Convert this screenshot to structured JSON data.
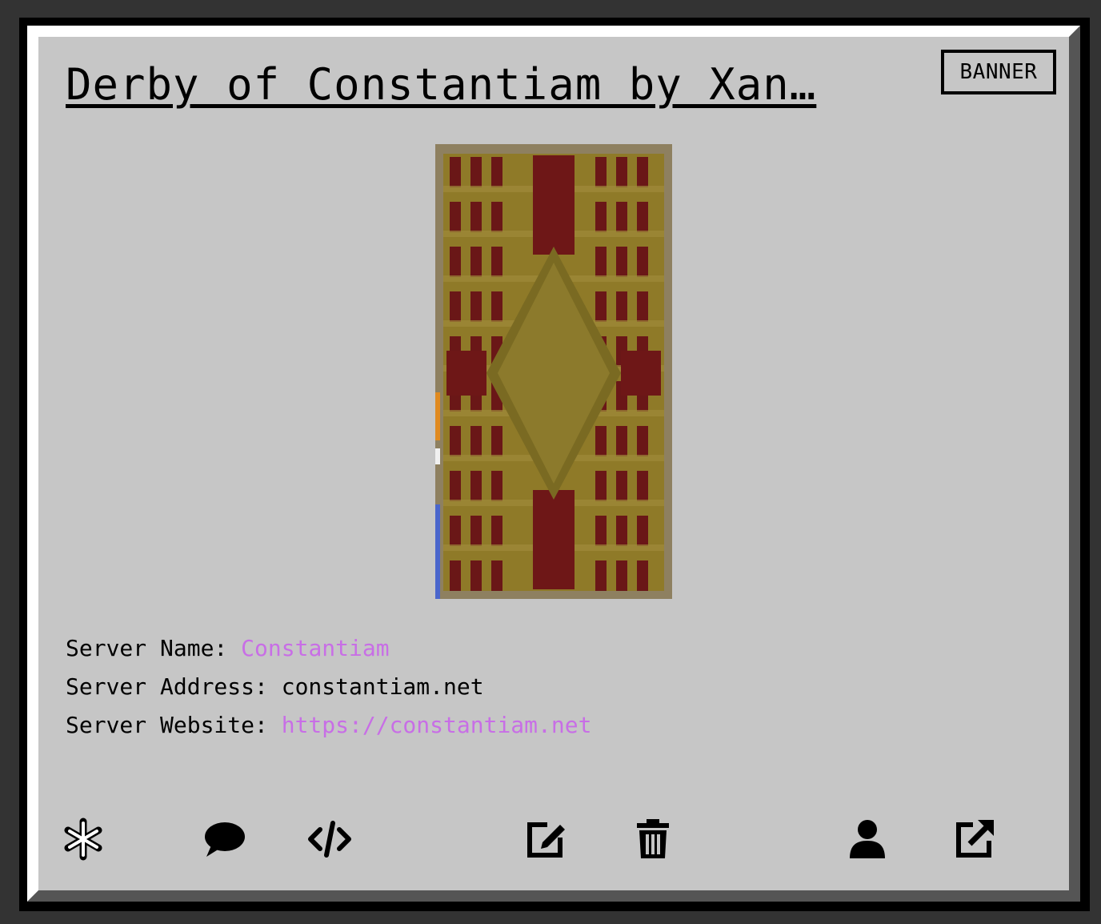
{
  "card": {
    "title": "Derby of Constantiam by Xan…",
    "type_badge": "BANNER"
  },
  "server": {
    "name_label": "Server Name: ",
    "name_value": "Constantiam",
    "address_label": "Server Address: ",
    "address_value": "constantiam.net",
    "website_label": "Server Website: ",
    "website_value": "https://constantiam.net"
  },
  "colors": {
    "background": "#333333",
    "card": "#c6c6c6",
    "link": "#c86ee6",
    "banner_base": "#8c7a2c",
    "banner_red": "#6e1717"
  },
  "actions": [
    {
      "icon": "asterisk-icon"
    },
    {
      "icon": "comment-icon"
    },
    {
      "icon": "code-icon"
    },
    {
      "icon": "edit-icon"
    },
    {
      "icon": "trash-icon"
    },
    {
      "icon": "user-icon"
    },
    {
      "icon": "external-link-icon"
    }
  ]
}
